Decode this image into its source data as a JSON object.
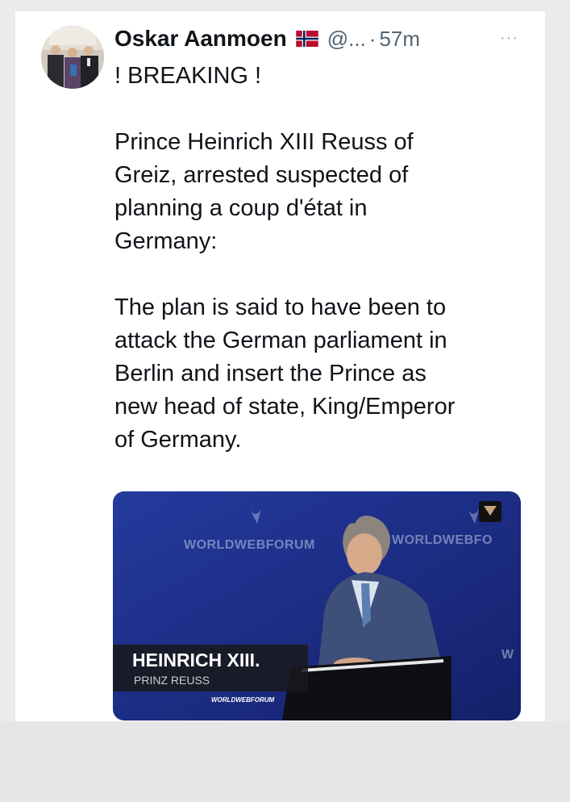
{
  "tweet": {
    "author_name": "Oskar Aanmoen",
    "flag_icon": "norway-flag-icon",
    "handle": "@...",
    "separator": "·",
    "timestamp": "57m",
    "more_label": "···",
    "text": "! BREAKING !\n\nPrince Heinrich XIII Reuss of\nGreiz, arrested suspected of\nplanning a coup d'état in\nGermany:\n\nThe plan is said to have been to\nattack the German parliament in\nBerlin and insert the Prince as\nnew head of state, King/Emperor\nof Germany."
  },
  "media": {
    "caption_title": "HEINRICH XIII.",
    "caption_subtitle": "PRINZ REUSS",
    "caption_brand": "WORLDWEBFORUM",
    "backdrop_left": "WORLDWEBFORUM",
    "backdrop_right": "WORLDWEBFO",
    "backdrop_edge": "W"
  },
  "colors": {
    "text": "#0f1419",
    "secondary": "#536471",
    "video_bg": "#1e2f8a"
  }
}
